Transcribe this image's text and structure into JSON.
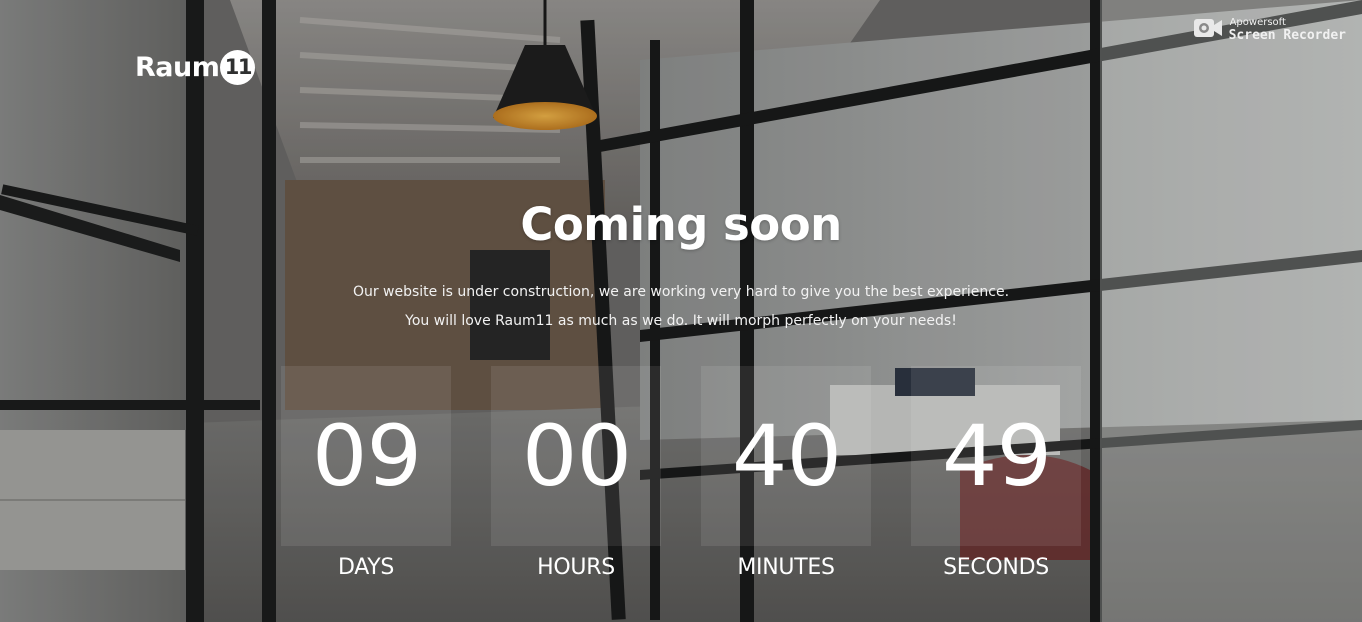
{
  "logo": {
    "text": "Raum",
    "number": "11"
  },
  "watermark": {
    "brand": "Apowersoft",
    "product": "Screen Recorder",
    "icon": "camera-icon"
  },
  "hero": {
    "title": "Coming soon",
    "subtitle_lines": [
      "Our website is under construction, we are working very hard to give you the best experience.",
      "You will love Raum11 as much as we do. It will morph perfectly on your needs!"
    ]
  },
  "countdown": [
    {
      "value": "09",
      "label": "DAYS"
    },
    {
      "value": "00",
      "label": "HOURS"
    },
    {
      "value": "40",
      "label": "MINUTES"
    },
    {
      "value": "49",
      "label": "SECONDS"
    }
  ],
  "colors": {
    "text": "#ffffff",
    "lamp_glow": "#e3a33c"
  }
}
